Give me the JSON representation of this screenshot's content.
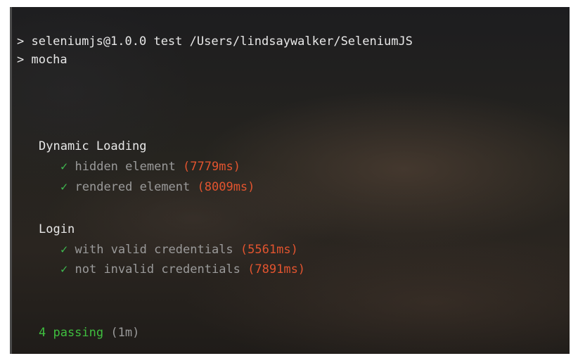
{
  "terminal": {
    "command_line": "> seleniumjs@1.0.0 test /Users/lindsaywalker/SeleniumJS",
    "runner_line": "> mocha",
    "suites": [
      {
        "title": "Dynamic Loading",
        "tests": [
          {
            "check": "✓",
            "title": "hidden element",
            "duration": "(7779ms)"
          },
          {
            "check": "✓",
            "title": "rendered element",
            "duration": "(8009ms)"
          }
        ]
      },
      {
        "title": "Login",
        "tests": [
          {
            "check": "✓",
            "title": "with valid credentials",
            "duration": "(5561ms)"
          },
          {
            "check": "✓",
            "title": "not invalid credentials",
            "duration": "(7891ms)"
          }
        ]
      }
    ],
    "summary": {
      "passing": "4 passing",
      "time": "(1m)"
    }
  },
  "colors": {
    "text": "#e8e8e8",
    "check": "#3fb950",
    "duration": "#e2542f",
    "passing": "#3fbf3f",
    "dim": "#9a9a9a"
  }
}
